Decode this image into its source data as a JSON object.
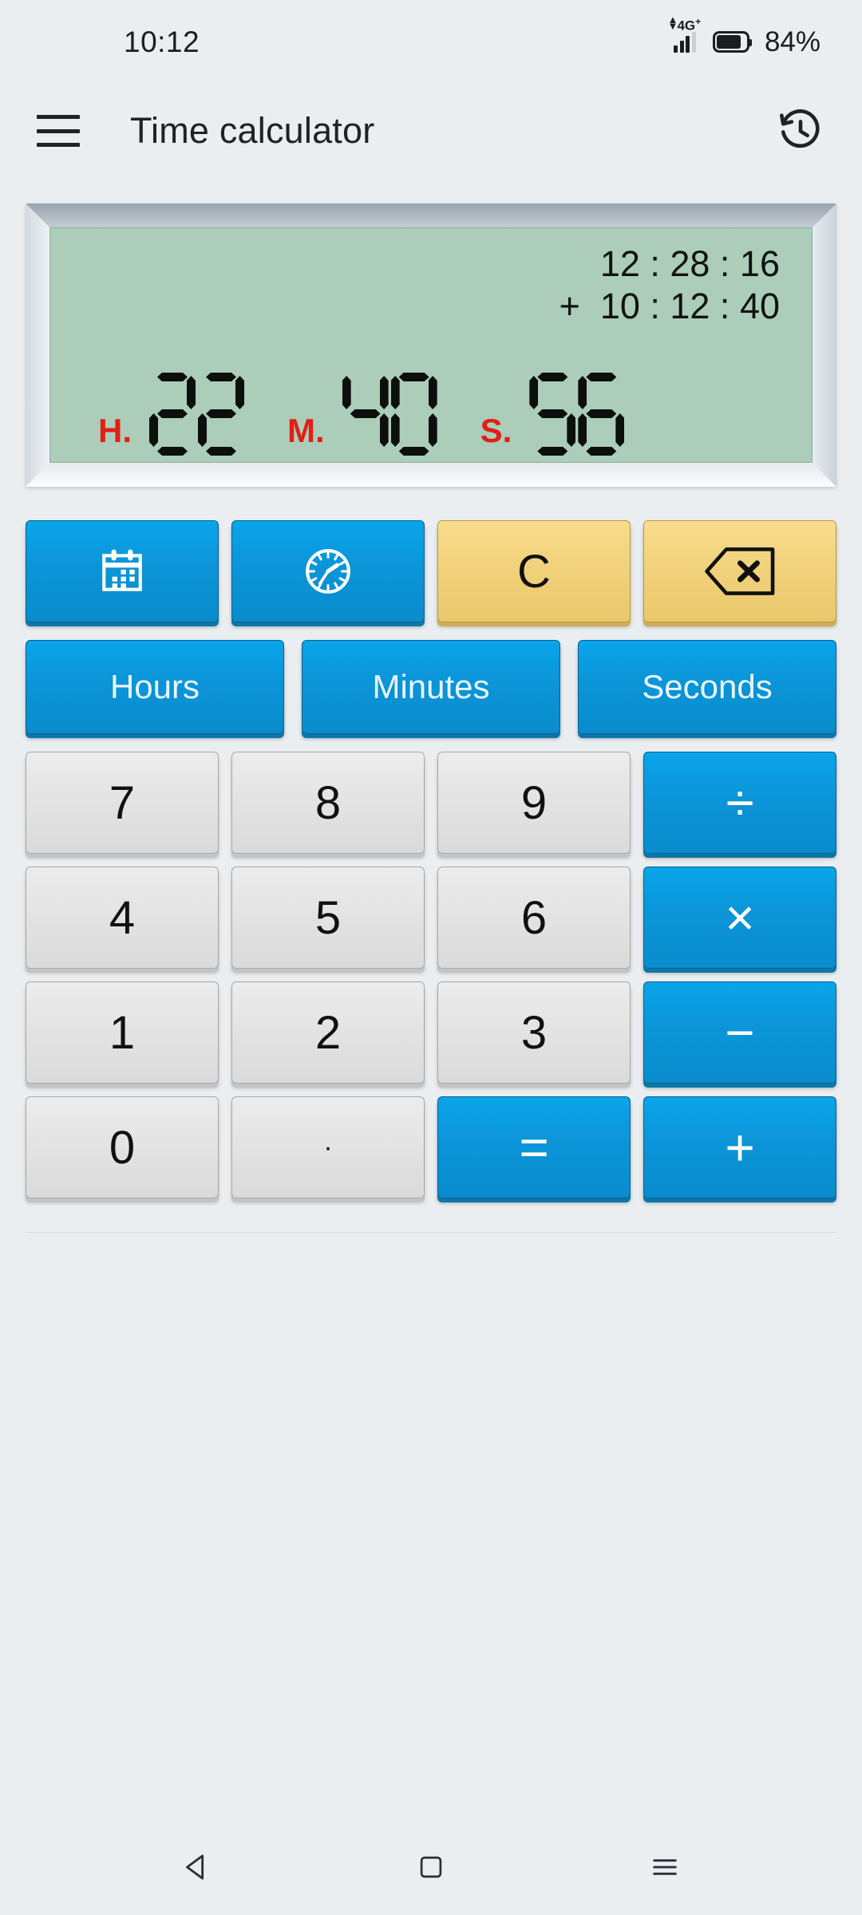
{
  "status_bar": {
    "time": "10:12",
    "network_label": "4G",
    "network_plus": "+",
    "battery_percent": "84%",
    "signal_icon": "signal-bars-icon",
    "battery_icon": "battery-icon"
  },
  "app_bar": {
    "menu_icon": "hamburger-menu-icon",
    "title": "Time calculator",
    "history_icon": "history-icon"
  },
  "display": {
    "expression_line1": "12 : 28 : 16",
    "expression_line2": "+  10 : 12 : 40",
    "result": {
      "hours_label": "H.",
      "hours_value": "22",
      "minutes_label": "M.",
      "minutes_value": "40",
      "seconds_label": "S.",
      "seconds_value": "56"
    },
    "lcd_color": "#abcdba",
    "label_color": "#e21f16",
    "digit_color": "#0c0f0b"
  },
  "keypad": {
    "function_row": [
      {
        "name": "calendar-button",
        "icon": "calendar-icon",
        "label": "",
        "style": "blue"
      },
      {
        "name": "clock-button",
        "icon": "clock-icon",
        "label": "",
        "style": "blue"
      },
      {
        "name": "clear-button",
        "icon": "",
        "label": "C",
        "style": "yellow"
      },
      {
        "name": "backspace-button",
        "icon": "backspace-icon",
        "label": "",
        "style": "yellow"
      }
    ],
    "unit_row": [
      {
        "name": "hours-button",
        "label": "Hours"
      },
      {
        "name": "minutes-button",
        "label": "Minutes"
      },
      {
        "name": "seconds-button",
        "label": "Seconds"
      }
    ],
    "digit_rows": [
      [
        {
          "name": "key-7",
          "label": "7",
          "style": "grey"
        },
        {
          "name": "key-8",
          "label": "8",
          "style": "grey"
        },
        {
          "name": "key-9",
          "label": "9",
          "style": "grey"
        },
        {
          "name": "key-divide",
          "label": "÷",
          "style": "blue"
        }
      ],
      [
        {
          "name": "key-4",
          "label": "4",
          "style": "grey"
        },
        {
          "name": "key-5",
          "label": "5",
          "style": "grey"
        },
        {
          "name": "key-6",
          "label": "6",
          "style": "grey"
        },
        {
          "name": "key-multiply",
          "label": "×",
          "style": "blue"
        }
      ],
      [
        {
          "name": "key-1",
          "label": "1",
          "style": "grey"
        },
        {
          "name": "key-2",
          "label": "2",
          "style": "grey"
        },
        {
          "name": "key-3",
          "label": "3",
          "style": "grey"
        },
        {
          "name": "key-minus",
          "label": "−",
          "style": "blue"
        }
      ],
      [
        {
          "name": "key-0",
          "label": "0",
          "style": "grey"
        },
        {
          "name": "key-decimal",
          "label": "·",
          "style": "grey"
        },
        {
          "name": "key-equals",
          "label": "=",
          "style": "blue"
        },
        {
          "name": "key-plus",
          "label": "+",
          "style": "blue"
        }
      ]
    ],
    "accent_blue": "#0b95d8",
    "accent_yellow": "#f0d078",
    "key_grey": "#e2e2e3"
  },
  "nav_bar": {
    "back_icon": "back-triangle-icon",
    "home_icon": "home-square-icon",
    "recents_icon": "recents-menu-icon"
  }
}
